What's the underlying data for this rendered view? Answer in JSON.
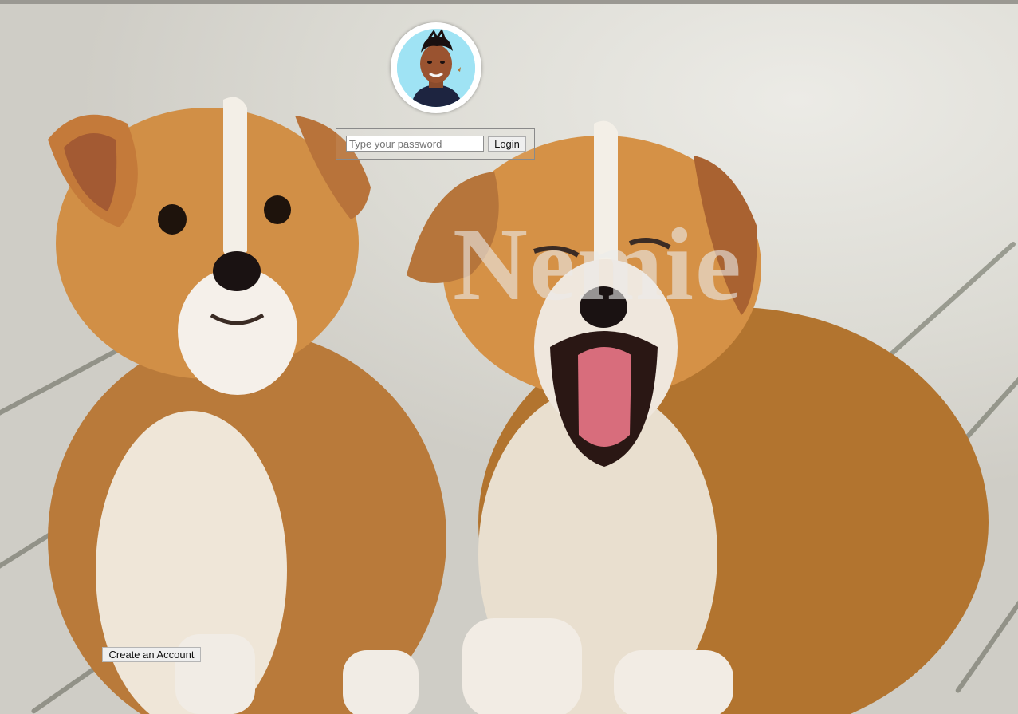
{
  "login": {
    "password_placeholder": "Type your password",
    "login_label": "Login"
  },
  "brand": {
    "name": "Nemie"
  },
  "signup": {
    "create_account_label": "Create an Account"
  },
  "colors": {
    "brand_text": "#ebebeb",
    "avatar_ring": "#ffffff",
    "avatar_bg": "#9fe3f4",
    "button_bg": "#efefef"
  }
}
